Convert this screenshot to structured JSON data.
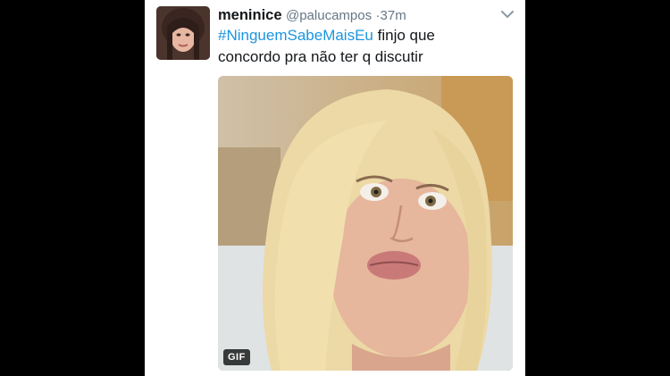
{
  "tweet": {
    "display_name": "meninice",
    "handle": "@palucampos",
    "separator": "·",
    "time": "37m",
    "hashtag": "#NinguemSabeMaisEu",
    "text_line1": " finjo que",
    "text_line2": "concordo pra não ter q discutir"
  },
  "media": {
    "badge": "GIF"
  },
  "colors": {
    "hashtag": "#1b95e0",
    "name": "#14171a",
    "secondary": "#657786",
    "background": "#000000",
    "card": "#ffffff"
  },
  "icons": {
    "caret": "chevron-down-icon"
  }
}
